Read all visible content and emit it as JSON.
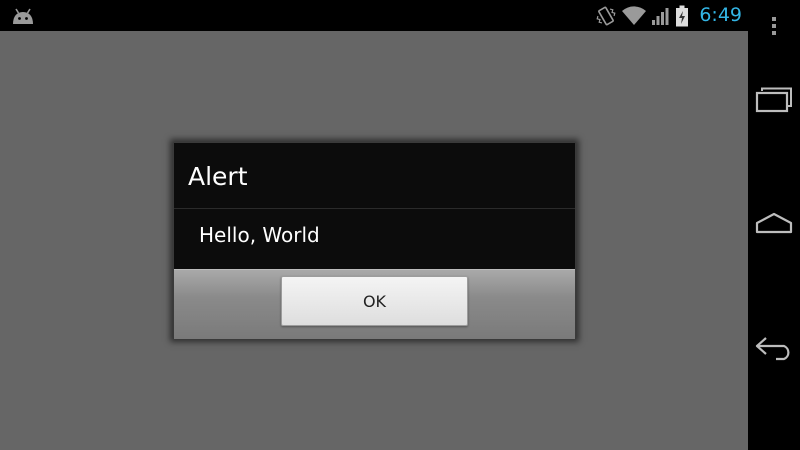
{
  "status_bar": {
    "notification_icon": "android-robot-icon",
    "icons": [
      "vibrate-icon",
      "wifi-icon",
      "cell-signal-icon",
      "battery-charging-icon"
    ],
    "time": "6:49",
    "accent_color": "#33b5e5"
  },
  "nav_bar": {
    "buttons": [
      "overflow-menu-icon",
      "recent-apps-icon",
      "home-icon",
      "back-icon"
    ]
  },
  "dialog": {
    "title": "Alert",
    "message": "Hello, World",
    "ok_label": "OK"
  }
}
